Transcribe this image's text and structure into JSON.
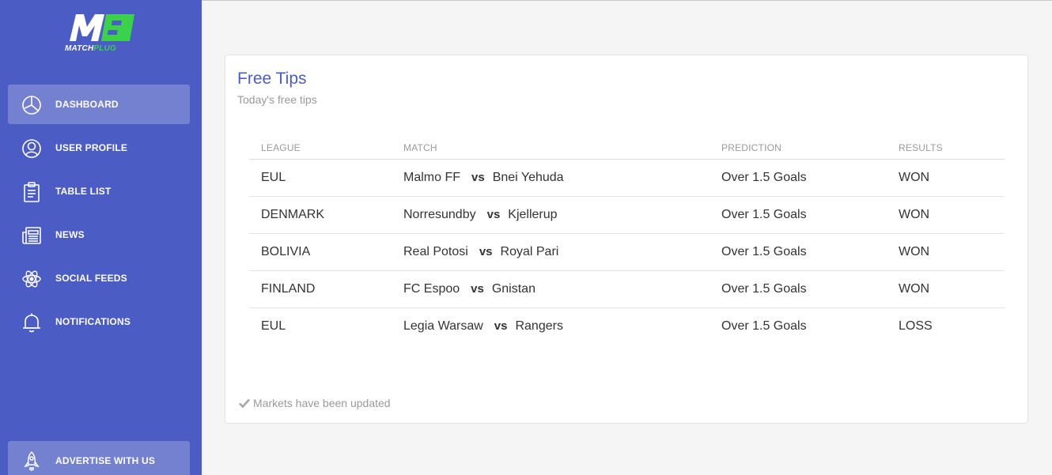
{
  "brand": {
    "logo_text_part1": "MATCH",
    "logo_text_part2": "PLUG",
    "colors": {
      "sidebar": "#4b5cc4",
      "accent_green": "#3bd14a",
      "title_blue": "#4b5cc4"
    }
  },
  "sidebar": {
    "items": [
      {
        "label": "DASHBOARD",
        "icon": "pie-chart-icon",
        "active": true
      },
      {
        "label": "USER PROFILE",
        "icon": "user-circle-icon",
        "active": false
      },
      {
        "label": "TABLE LIST",
        "icon": "clipboard-icon",
        "active": false
      },
      {
        "label": "NEWS",
        "icon": "newspaper-icon",
        "active": false
      },
      {
        "label": "SOCIAL FEEDS",
        "icon": "atom-icon",
        "active": false
      },
      {
        "label": "NOTIFICATIONS",
        "icon": "bell-icon",
        "active": false
      }
    ],
    "bottom_item": {
      "label": "ADVERTISE WITH US",
      "icon": "rocket-icon",
      "active": true
    }
  },
  "card": {
    "title": "Free Tips",
    "subtitle": "Today's free tips",
    "columns": {
      "league": "LEAGUE",
      "match": "MATCH",
      "prediction": "PREDICTION",
      "results": "RESULTS"
    },
    "vs_label": "vs",
    "rows": [
      {
        "league": "EUL",
        "home": "Malmo FF",
        "away": "Bnei Yehuda",
        "prediction": "Over 1.5 Goals",
        "result": "WON"
      },
      {
        "league": "DENMARK",
        "home": "Norresundby",
        "away": "Kjellerup",
        "prediction": "Over 1.5 Goals",
        "result": "WON"
      },
      {
        "league": "BOLIVIA",
        "home": "Real Potosi",
        "away": "Royal Pari",
        "prediction": "Over 1.5 Goals",
        "result": "WON"
      },
      {
        "league": "FINLAND",
        "home": "FC Espoo",
        "away": "Gnistan",
        "prediction": "Over 1.5 Goals",
        "result": "WON"
      },
      {
        "league": "EUL",
        "home": "Legia Warsaw",
        "away": "Rangers",
        "prediction": "Over 1.5 Goals",
        "result": "LOSS"
      }
    ],
    "footer_note": "Markets have been updated",
    "footer_icon": "check-icon"
  }
}
